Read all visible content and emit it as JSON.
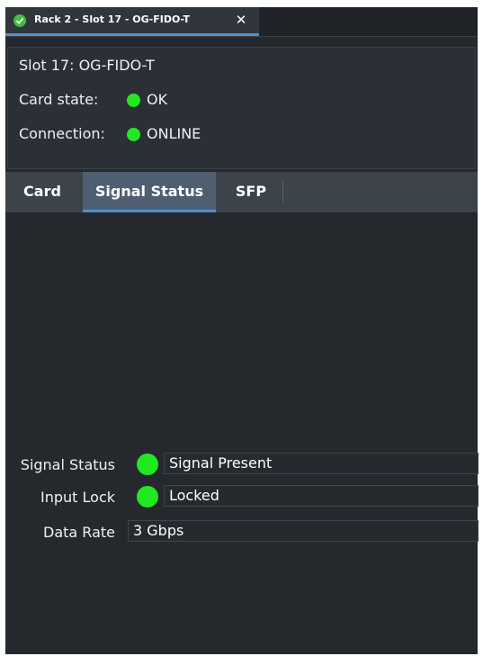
{
  "window": {
    "tab_title": "Rack 2 - Slot 17 - OG-FIDO-T",
    "close_label": "✕"
  },
  "card_info": {
    "slot_line": "Slot 17: OG-FIDO-T",
    "card_state_label": "Card state:",
    "card_state_value": "OK",
    "connection_label": "Connection:",
    "connection_value": "ONLINE",
    "status_color": "#22e822"
  },
  "tabs": [
    {
      "label": "Card",
      "active": false
    },
    {
      "label": "Signal Status",
      "active": true
    },
    {
      "label": "SFP",
      "active": false
    }
  ],
  "signal": {
    "signal_status_label": "Signal Status",
    "signal_status_value": "Signal Present",
    "input_lock_label": "Input Lock",
    "input_lock_value": "Locked",
    "data_rate_label": "Data Rate",
    "data_rate_value": "3 Gbps"
  },
  "colors": {
    "accent": "#4a90d0",
    "indicator_green": "#22e822",
    "panel_background": "#25292e"
  }
}
